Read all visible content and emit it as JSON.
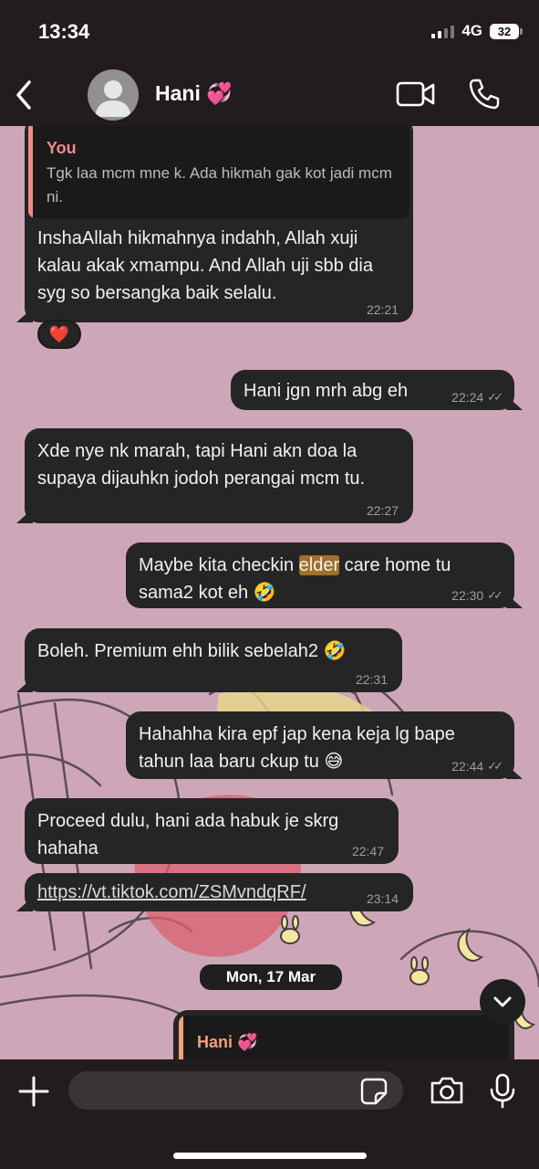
{
  "status_bar": {
    "time": "13:34",
    "network": "4G",
    "battery": "32"
  },
  "header": {
    "contact_name": "Hani 💞",
    "icons": [
      "back-chevron-icon",
      "avatar-icon",
      "video-call-icon",
      "phone-icon"
    ]
  },
  "messages": [
    {
      "side": "incoming",
      "quote": {
        "author": "You",
        "text": "Tgk laa mcm mne k. Ada hikmah gak kot jadi mcm ni."
      },
      "text": "InshaAllah hikmahnya indahh, Allah xuji kalau akak xmampu. And Allah uji sbb dia syg so bersangka baik selalu.",
      "time": "22:21",
      "reaction": "❤️"
    },
    {
      "side": "outgoing",
      "text": "Hani jgn mrh abg eh",
      "time": "22:24",
      "read": true
    },
    {
      "side": "incoming",
      "text": "Xde nye nk marah, tapi Hani akn doa la supaya dijauhkn jodoh perangai mcm tu.",
      "time": "22:27"
    },
    {
      "side": "outgoing",
      "text_before": "Maybe kita checkin ",
      "highlight": "elder",
      "text_after": " care home tu sama2 kot eh 🤣",
      "time": "22:30",
      "read": true
    },
    {
      "side": "incoming",
      "text": "Boleh. Premium ehh bilik sebelah2 🤣",
      "time": "22:31"
    },
    {
      "side": "outgoing",
      "text": "Hahahha kira epf jap kena keja lg bape tahun laa baru ckup tu 😅",
      "time": "22:44",
      "read": true
    },
    {
      "side": "incoming",
      "text": "Proceed dulu, hani ada habuk je skrg hahaha",
      "time": "22:47"
    },
    {
      "side": "incoming",
      "link": "https://vt.tiktok.com/ZSMvndqRF/",
      "time": "23:14"
    }
  ],
  "date_separator": "Mon, 17 Mar",
  "partial_message": {
    "quote_author": "Hani 💞"
  },
  "input": {
    "placeholder": "",
    "value": ""
  },
  "colors": {
    "header_bg": "#221c1f",
    "bubble_bg": "#252525",
    "quote_you": "#f08a8a",
    "quote_hani": "#f0a07a",
    "highlight": "#a0702a",
    "wallpaper": "#cfa8b8"
  }
}
